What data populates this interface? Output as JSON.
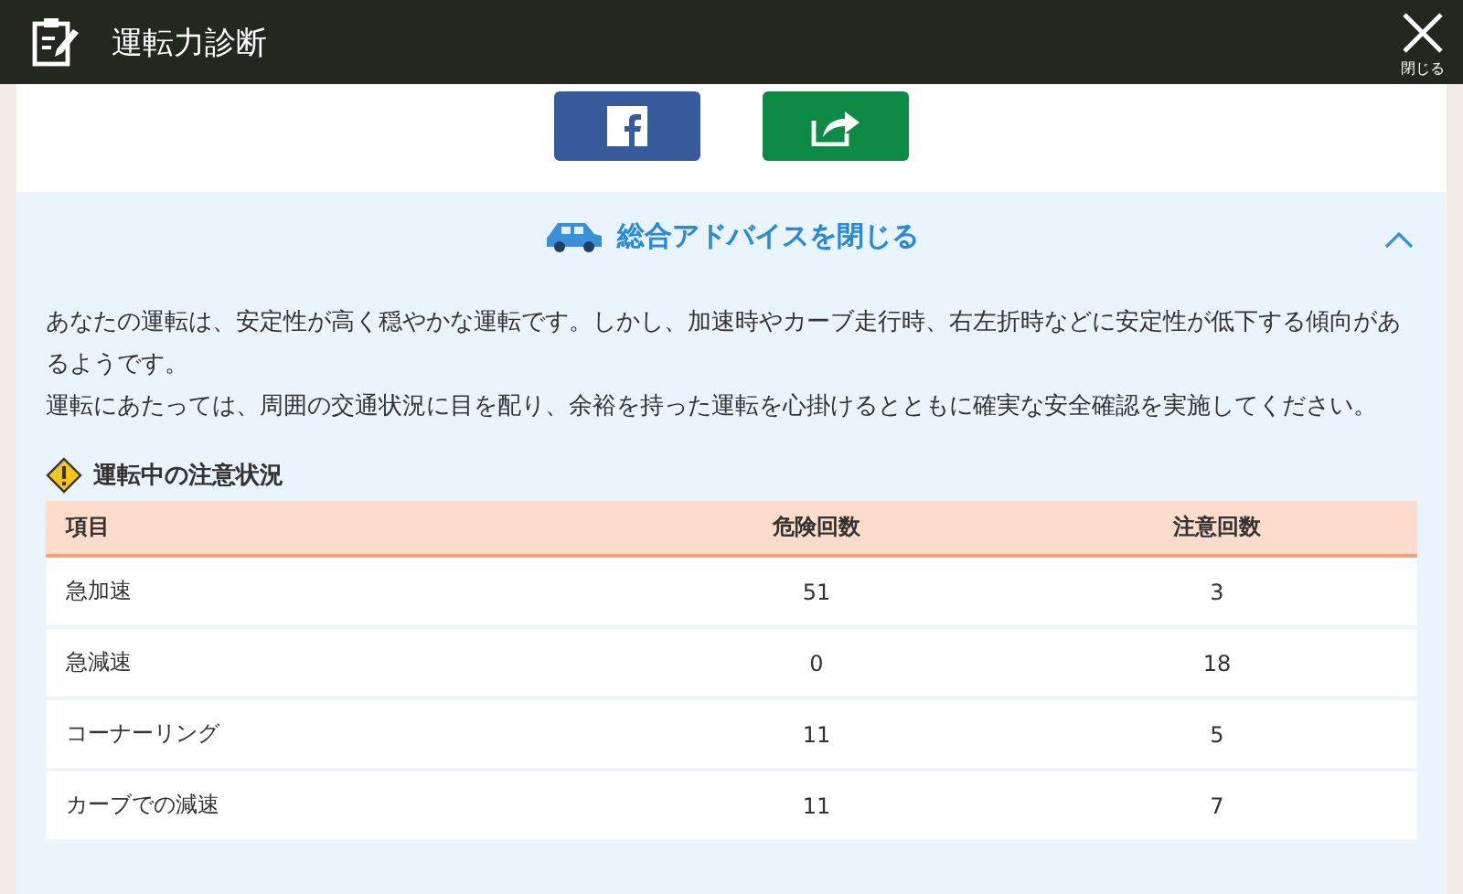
{
  "header": {
    "title": "運転力診断",
    "close_label": "閉じる"
  },
  "share_buttons": [
    {
      "kind": "facebook"
    },
    {
      "kind": "share"
    }
  ],
  "advice": {
    "toggle_label": "総合アドバイスを閉じる",
    "expanded": true,
    "paragraphs": [
      "あなたの運転は、安定性が高く穏やかな運転です。しかし、加速時やカーブ走行時、右左折時などに安定性が低下する傾向があるようです。",
      "運転にあたっては、周囲の交通状況に目を配り、余裕を持った運転を心掛けるとともに確実な安全確認を実施してください。"
    ]
  },
  "caution": {
    "title": "運転中の注意状況",
    "table": {
      "columns": [
        "項目",
        "危険回数",
        "注意回数"
      ],
      "rows": [
        [
          "急加速",
          "51",
          "3"
        ],
        [
          "急減速",
          "0",
          "18"
        ],
        [
          "コーナーリング",
          "11",
          "5"
        ],
        [
          "カーブでの減速",
          "11",
          "7"
        ]
      ]
    }
  }
}
